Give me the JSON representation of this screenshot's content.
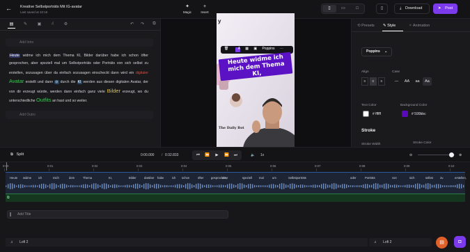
{
  "topbar": {
    "title": "Kreative Selbstporträts Mit IG-avatar",
    "subtitle": "Last saved at 10:16",
    "magic_label": "Magic",
    "insert_label": "Insert",
    "download_label": "Download",
    "post_label": "Post"
  },
  "left": {
    "add_intro": "Add Intro",
    "add_outro": "Add Outro",
    "transcript": {
      "p1": "Heute",
      "p2": " widme ich mich dem Thema KI, Bilder darüber habe ich schon öfter gesprochen, aber speziell mal um Selbstporträts oder Porträts von sich selbst zu erstellen, sozusagen über ",
      "p3": "da einfach sozusagen einscheckt dann wird ein ",
      "p4": "digitaler",
      "p5": " Avatar",
      "p6": " erstellt und dann ",
      "p7": "⊙",
      "p8": " durch",
      "p9": " die ",
      "p10": "KI",
      "p11": " werden aus diesen digitalen Avatar, der von dir erzeugt würde, werden dann einfach ganz viele ",
      "p12": "Bilder",
      "p13": " erzeugt, wo du unterschiedliche ",
      "p14": "Outfits",
      "p15": " an hast und so weiter."
    }
  },
  "preview": {
    "caption": "Heute widme ich mich dem Thema KI,",
    "font_label": "Poppins",
    "watermark": "The Daily Bot",
    "corner_text": "y"
  },
  "right": {
    "tabs": [
      "Presets",
      "Style",
      "Animation"
    ],
    "font": "Poppins",
    "align_label": "Align",
    "case_label": "Case",
    "case_options": [
      "—",
      "AA",
      "aa",
      "Aa"
    ],
    "text_color_label": "Text Color",
    "text_color": "# ffffff",
    "text_color_hex": "#ffffff",
    "bg_color_label": "Background Color",
    "bg_color": "# 590bbc",
    "bg_color_hex": "#590bbc",
    "stroke_title": "Stroke",
    "stroke_width_label": "Stroke Width",
    "stroke_color_label": "Stroke Color"
  },
  "transport": {
    "split_label": "Split",
    "current_time": "0:00.000",
    "total_time": "0:32.833",
    "speed": "1x"
  },
  "timeline": {
    "ticks": [
      "0:00",
      "0:01",
      "0:02",
      "0:03",
      "0:04",
      "0:05",
      "0:06",
      "0:07",
      "0:08",
      "0:09",
      "0:10"
    ],
    "words": [
      "Heute",
      "widme",
      "ich",
      "mich",
      "dem",
      "Thema",
      "KI,",
      "Bilder",
      "darüber",
      "habe",
      "ich",
      "schon",
      "öfter",
      "gesprochen,",
      "aber",
      "speziell",
      "mal",
      "um",
      "Selbstporträts",
      "oder",
      "Porträts",
      "von",
      "sich",
      "selbst",
      "zu",
      "erstellen,"
    ],
    "add_title": "Add Title",
    "audio_label": "Lofi 2"
  }
}
